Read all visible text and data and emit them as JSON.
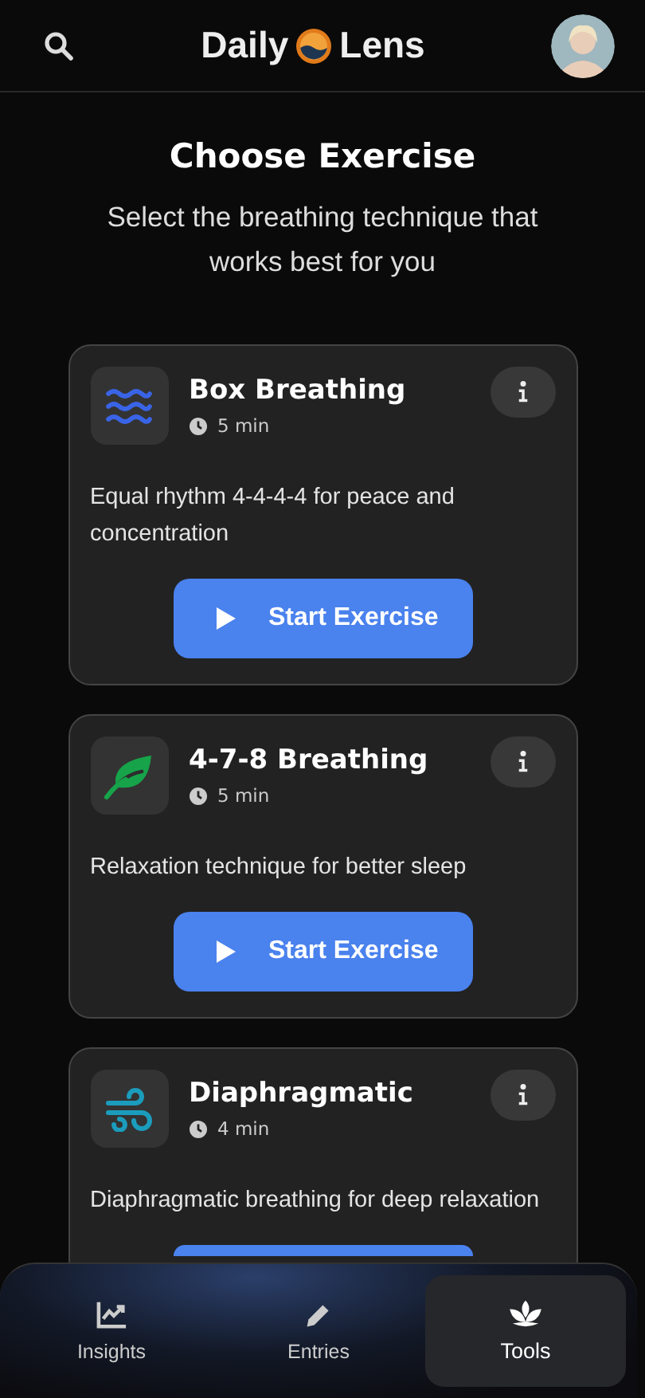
{
  "header": {
    "title_left": "Daily",
    "title_right": "Lens"
  },
  "heading": "Choose Exercise",
  "subheading": "Select the breathing technique that works best for you",
  "exercises": [
    {
      "kind": "waves",
      "title": "Box Breathing",
      "duration": "5 min",
      "description": "Equal rhythm 4-4-4-4 for peace and concentration",
      "button": "Start Exercise"
    },
    {
      "kind": "leaf",
      "title": "4-7-8 Breathing",
      "duration": "5 min",
      "description": "Relaxation technique for better sleep",
      "button": "Start Exercise"
    },
    {
      "kind": "wind",
      "title": "Diaphragmatic",
      "duration": "4 min",
      "description": "Diaphragmatic breathing for deep relaxation"
    }
  ],
  "nav": [
    {
      "kind": "chart",
      "label": "Insights",
      "selected": false
    },
    {
      "kind": "pencil",
      "label": "Entries",
      "selected": false
    },
    {
      "kind": "lotus",
      "label": "Tools",
      "selected": true
    }
  ]
}
